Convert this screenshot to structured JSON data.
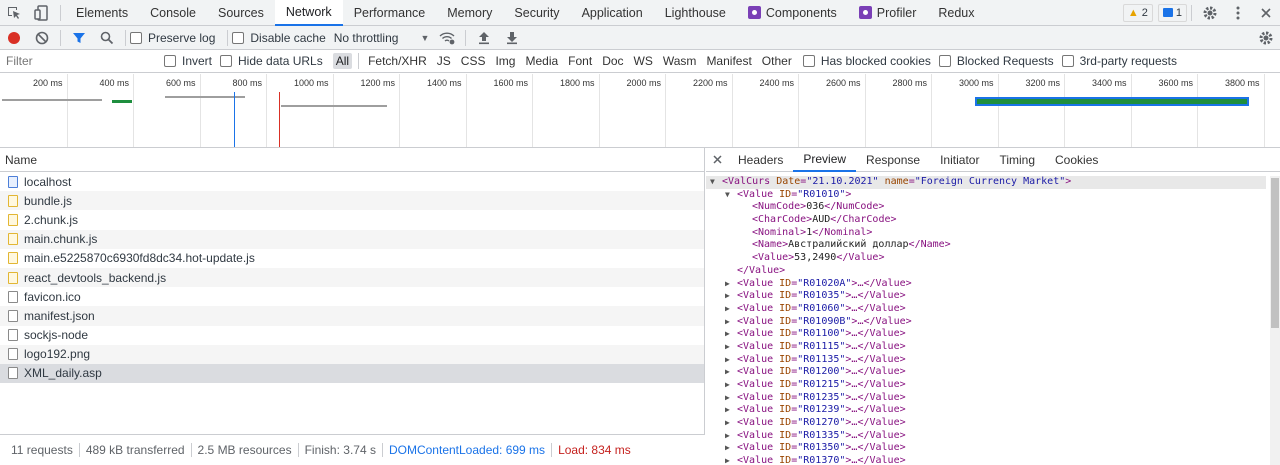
{
  "tabs": {
    "items": [
      "Elements",
      "Console",
      "Sources",
      "Network",
      "Performance",
      "Memory",
      "Security",
      "Application",
      "Lighthouse",
      "Components",
      "Profiler",
      "Redux"
    ],
    "active": "Network",
    "warn_count": "2",
    "msg_count": "1"
  },
  "toolbar": {
    "preserve_log": "Preserve log",
    "disable_cache": "Disable cache",
    "throttling": "No throttling"
  },
  "filter": {
    "placeholder": "Filter",
    "invert": "Invert",
    "hide_data_urls": "Hide data URLs",
    "types": [
      "All",
      "Fetch/XHR",
      "JS",
      "CSS",
      "Img",
      "Media",
      "Font",
      "Doc",
      "WS",
      "Wasm",
      "Manifest",
      "Other"
    ],
    "blocked_cookies": "Has blocked cookies",
    "blocked_requests": "Blocked Requests",
    "third_party": "3rd-party requests"
  },
  "overview": {
    "ticks": [
      "200 ms",
      "400 ms",
      "600 ms",
      "800 ms",
      "1000 ms",
      "1200 ms",
      "1400 ms",
      "1600 ms",
      "1800 ms",
      "2000 ms",
      "2200 ms",
      "2400 ms",
      "2600 ms",
      "2800 ms",
      "3000 ms",
      "3200 ms",
      "3400 ms",
      "3600 ms",
      "3800 ms"
    ]
  },
  "requests": {
    "header": "Name",
    "items": [
      {
        "name": "localhost",
        "type": "doc"
      },
      {
        "name": "bundle.js",
        "type": "js"
      },
      {
        "name": "2.chunk.js",
        "type": "js"
      },
      {
        "name": "main.chunk.js",
        "type": "js"
      },
      {
        "name": "main.e5225870c6930fd8dc34.hot-update.js",
        "type": "js"
      },
      {
        "name": "react_devtools_backend.js",
        "type": "js"
      },
      {
        "name": "favicon.ico",
        "type": "other"
      },
      {
        "name": "manifest.json",
        "type": "other"
      },
      {
        "name": "sockjs-node",
        "type": "other"
      },
      {
        "name": "logo192.png",
        "type": "other"
      },
      {
        "name": "XML_daily.asp",
        "type": "other"
      }
    ],
    "selected": "XML_daily.asp"
  },
  "status": {
    "requests": "11 requests",
    "transferred": "489 kB transferred",
    "resources": "2.5 MB resources",
    "finish": "Finish: 3.74 s",
    "dom": "DOMContentLoaded: 699 ms",
    "load": "Load: 834 ms"
  },
  "detail": {
    "tabs": [
      "Headers",
      "Preview",
      "Response",
      "Initiator",
      "Timing",
      "Cookies"
    ],
    "active": "Preview"
  },
  "preview": {
    "root": {
      "tag": "ValCurs",
      "date": "21.10.2021",
      "name": "Foreign Currency Market"
    },
    "first": {
      "id": "R01010",
      "NumCode": "036",
      "CharCode": "AUD",
      "Nominal": "1",
      "Name": "Австралийский доллар",
      "Value": "53,2490"
    },
    "collapsed_ids": [
      "R01020A",
      "R01035",
      "R01060",
      "R01090B",
      "R01100",
      "R01115",
      "R01135",
      "R01200",
      "R01215",
      "R01235",
      "R01239",
      "R01270",
      "R01335",
      "R01350",
      "R01370"
    ]
  }
}
